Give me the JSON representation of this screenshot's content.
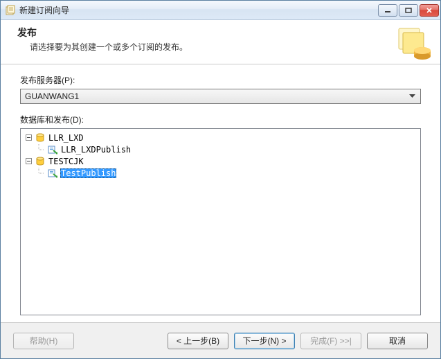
{
  "window": {
    "title": "新建订阅向导"
  },
  "header": {
    "title": "发布",
    "subtitle": "请选择要为其创建一个或多个订阅的发布。"
  },
  "form": {
    "server_label": "发布服务器(P):",
    "server_value": "GUANWANG1",
    "tree_label": "数据库和发布(D):"
  },
  "tree": {
    "nodes": [
      {
        "name": "LLR_LXD",
        "expanded": true,
        "type": "database",
        "children": [
          {
            "name": "LLR_LXDPublish",
            "type": "publication",
            "selected": false
          }
        ]
      },
      {
        "name": "TESTCJK",
        "expanded": true,
        "type": "database",
        "children": [
          {
            "name": "TestPublish",
            "type": "publication",
            "selected": true
          }
        ]
      }
    ]
  },
  "footer": {
    "help": "帮助(H)",
    "back": "< 上一步(B)",
    "next": "下一步(N) >",
    "finish": "完成(F) >>|",
    "cancel": "取消"
  }
}
